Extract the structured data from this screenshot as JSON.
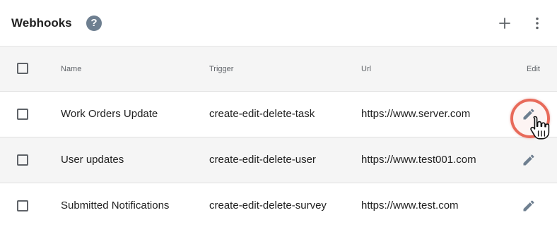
{
  "header": {
    "title": "Webhooks",
    "help_icon": "help-circle-icon",
    "add_icon": "plus-icon",
    "menu_icon": "more-vertical-icon"
  },
  "table": {
    "columns": [
      "Name",
      "Trigger",
      "Url",
      "Edit"
    ],
    "rows": [
      {
        "name": "Work Orders Update",
        "trigger": "create-edit-delete-task",
        "url": "https://www.server.com"
      },
      {
        "name": "User updates",
        "trigger": "create-edit-delete-user",
        "url": "https://www.test001.com"
      },
      {
        "name": "Submitted Notifications",
        "trigger": "create-edit-delete-survey",
        "url": "https://www.test.com"
      }
    ]
  },
  "colors": {
    "accent_ring": "#e86a5a",
    "icon_gray": "#6e7f90",
    "row_alt_bg": "#f5f5f5"
  }
}
